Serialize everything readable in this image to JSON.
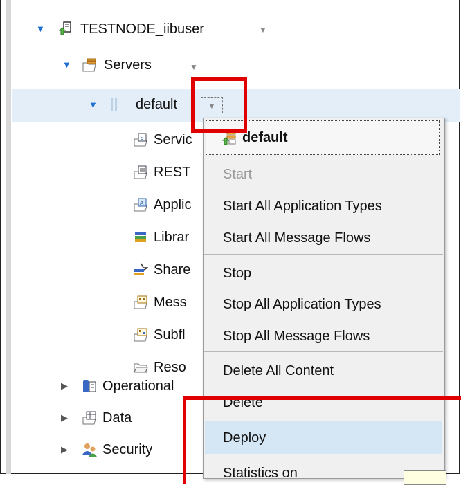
{
  "tree": {
    "node": "TESTNODE_iibuser",
    "servers": "Servers",
    "server": "default",
    "children": [
      "Servic",
      "REST",
      "Applic",
      "Librar",
      "Share",
      "Mess",
      "Subfl",
      "Reso"
    ],
    "operational": "Operational",
    "data": "Data",
    "security": "Security"
  },
  "menu": {
    "header": "default",
    "items": {
      "start": "Start",
      "start_all_app_types": "Start All Application Types",
      "start_all_msg_flows": "Start All Message Flows",
      "stop": "Stop",
      "stop_all_app_types": "Stop All Application Types",
      "stop_all_msg_flows": "Stop All Message Flows",
      "delete_all_content": "Delete All Content",
      "delete": "Delete",
      "deploy": "Deploy",
      "statistics_on": "Statistics on"
    }
  },
  "icons": {
    "expand": "triangle-down-icon",
    "collapse": "triangle-right-icon",
    "dropdown": "chevron-down-icon"
  },
  "colors": {
    "selection": "#e3eef8",
    "highlight_red": "#e00000",
    "menu_hover": "#d5e6f5",
    "menu_bg": "#f0f0f0"
  }
}
